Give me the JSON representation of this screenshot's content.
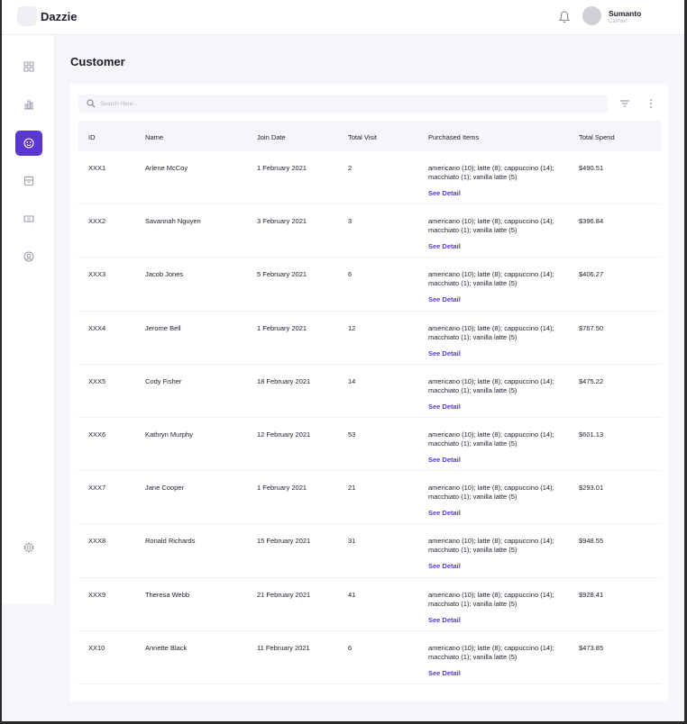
{
  "app": {
    "brand": "Dazzie"
  },
  "user": {
    "name": "Sumanto",
    "role": "Cashier"
  },
  "page": {
    "title": "Customer"
  },
  "search": {
    "placeholder": "Search Here..."
  },
  "table": {
    "headers": [
      "ID",
      "Name",
      "Join Date",
      "Total Visit",
      "Purchased Items",
      "Total Spend"
    ],
    "rows": [
      {
        "id": "XXX1",
        "name": "Arlene McCoy",
        "join": "1 February 2021",
        "visit": "2",
        "items": "americano (10); latte (8); cappuccino (14); macchiato (1); vanilla latte (5)",
        "spend": "$490.51",
        "detail": "See Detail"
      },
      {
        "id": "XXX2",
        "name": "Savannah Nguyen",
        "join": "3 February 2021",
        "visit": "3",
        "items": "americano (10); latte (8); cappuccino (14); macchiato (1); vanilla latte (5)",
        "spend": "$396.84",
        "detail": "See Detail"
      },
      {
        "id": "XXX3",
        "name": "Jacob Jones",
        "join": "5 February 2021",
        "visit": "6",
        "items": "americano (10); latte (8); cappuccino (14); macchiato (1); vanilla latte (5)",
        "spend": "$406.27",
        "detail": "See Detail"
      },
      {
        "id": "XXX4",
        "name": "Jerome Bell",
        "join": "1 February 2021",
        "visit": "12",
        "items": "americano (10); latte (8); cappuccino (14); macchiato (1); vanilla latte (5)",
        "spend": "$767.50",
        "detail": "See Detail"
      },
      {
        "id": "XXX5",
        "name": "Cody Fisher",
        "join": "18 February 2021",
        "visit": "14",
        "items": "americano (10); latte (8); cappuccino (14); macchiato (1); vanilla latte (5)",
        "spend": "$475.22",
        "detail": "See Detail"
      },
      {
        "id": "XXX6",
        "name": "Kathryn Murphy",
        "join": "12 February 2021",
        "visit": "53",
        "items": "americano (10); latte (8); cappuccino (14); macchiato (1); vanilla latte (5)",
        "spend": "$601.13",
        "detail": "See Detail"
      },
      {
        "id": "XXX7",
        "name": "Jane Cooper",
        "join": "1 February 2021",
        "visit": "21",
        "items": "americano (10); latte (8); cappuccino (14); macchiato (1); vanilla latte (5)",
        "spend": "$293.01",
        "detail": "See Detail"
      },
      {
        "id": "XXX8",
        "name": "Ronald Richards",
        "join": "15 February 2021",
        "visit": "31",
        "items": "americano (10); latte (8); cappuccino (14); macchiato (1); vanilla latte (5)",
        "spend": "$948.55",
        "detail": "See Detail"
      },
      {
        "id": "XXX9",
        "name": "Theresa Webb",
        "join": "21 February 2021",
        "visit": "41",
        "items": "americano (10); latte (8); cappuccino (14); macchiato (1); vanilla latte (5)",
        "spend": "$928.41",
        "detail": "See Detail"
      },
      {
        "id": "XX10",
        "name": "Annette Black",
        "join": "11 February 2021",
        "visit": "6",
        "items": "americano (10); latte (8); cappuccino (14); macchiato (1); vanilla latte (5)",
        "spend": "$473.85",
        "detail": "See Detail"
      }
    ]
  },
  "sidebar": {
    "items": [
      {
        "icon": "dashboard-grid-icon"
      },
      {
        "icon": "bar-chart-icon"
      },
      {
        "icon": "customer-icon",
        "active": true
      },
      {
        "icon": "archive-icon"
      },
      {
        "icon": "ticket-icon"
      },
      {
        "icon": "user-circle-icon"
      }
    ],
    "settings_icon": "gear-icon"
  },
  "colors": {
    "accent": "#5a37d2",
    "background": "#f6f6fa"
  }
}
